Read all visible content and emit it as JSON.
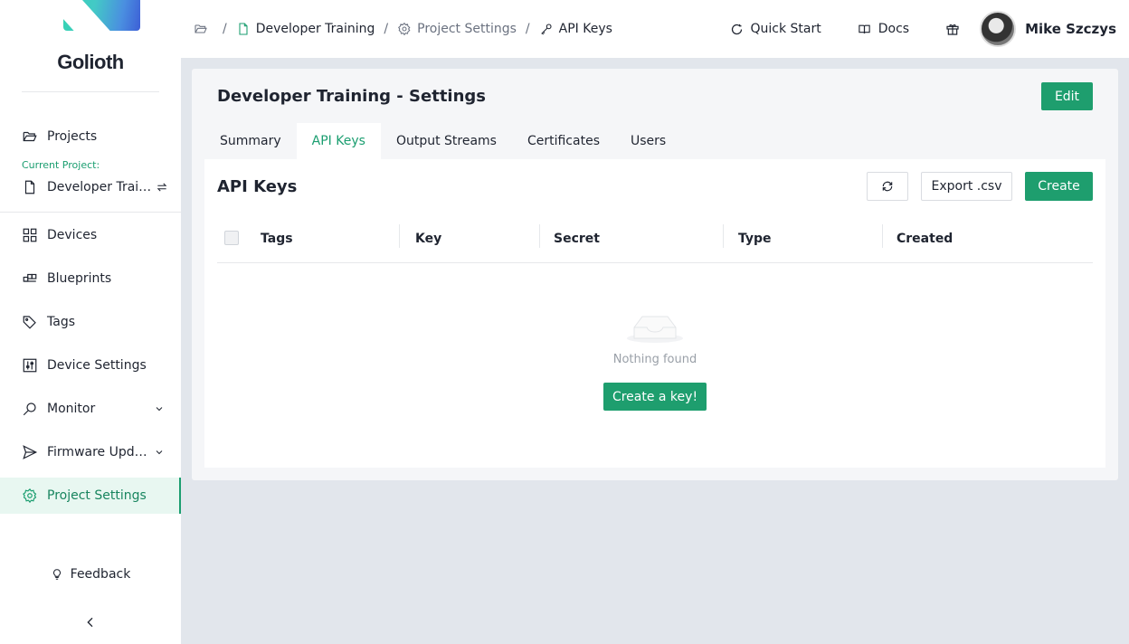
{
  "app": {
    "logo_text": "Golioth"
  },
  "sidebar": {
    "projects_label": "Projects",
    "current_project_label": "Current Project:",
    "current_project_name": "Developer Training",
    "items": [
      {
        "label": "Devices",
        "icon": "grid-icon"
      },
      {
        "label": "Blueprints",
        "icon": "blueprint-icon"
      },
      {
        "label": "Tags",
        "icon": "tag-icon"
      },
      {
        "label": "Device Settings",
        "icon": "sliders-icon"
      },
      {
        "label": "Monitor",
        "icon": "monitor-icon"
      },
      {
        "label": "Firmware Updates",
        "icon": "send-icon"
      },
      {
        "label": "Project Settings",
        "icon": "gear-icon"
      }
    ],
    "feedback_label": "Feedback"
  },
  "breadcrumb": {
    "project": "Developer Training",
    "settings": "Project Settings",
    "current": "API Keys"
  },
  "header": {
    "quick_start": "Quick Start",
    "docs": "Docs",
    "user_name": "Mike Szczys"
  },
  "settings": {
    "title": "Developer Training - Settings",
    "edit_label": "Edit",
    "tabs": [
      "Summary",
      "API Keys",
      "Output Streams",
      "Certificates",
      "Users"
    ],
    "active_tab": "API Keys"
  },
  "api_keys": {
    "title": "API Keys",
    "export_label": "Export .csv",
    "create_label": "Create",
    "columns": [
      "Tags",
      "Key",
      "Secret",
      "Type",
      "Created"
    ],
    "empty_text": "Nothing found",
    "create_key_label": "Create a key!"
  },
  "colors": {
    "accent": "#1e9e6e",
    "background": "#e2e6ec"
  }
}
